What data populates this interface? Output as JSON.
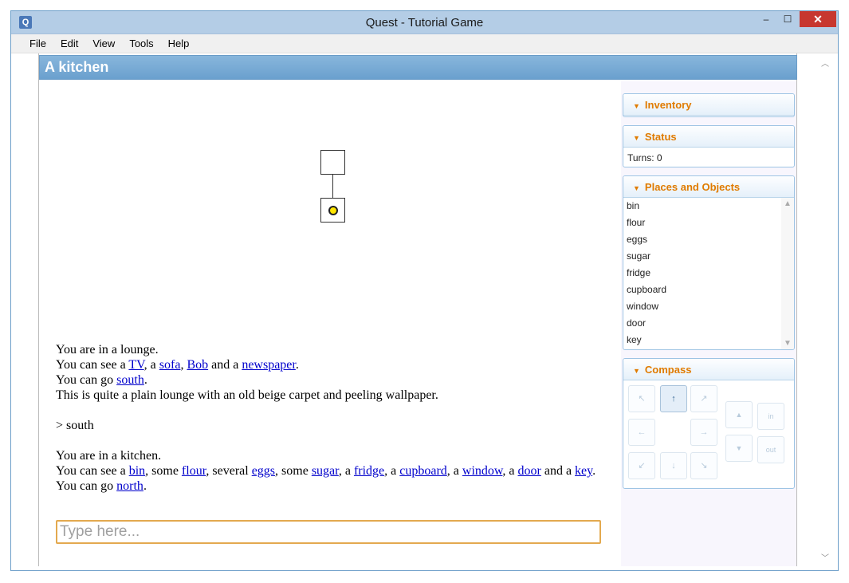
{
  "window": {
    "title": "Quest - Tutorial Game",
    "controls": {
      "minimize": "‒",
      "maximize": "☐",
      "close": "✕"
    }
  },
  "menu": [
    "File",
    "Edit",
    "View",
    "Tools",
    "Help"
  ],
  "location": {
    "title": "A kitchen"
  },
  "output": {
    "lines": [
      [
        {
          "t": "You are in a lounge."
        }
      ],
      [
        {
          "t": "You can see a "
        },
        {
          "t": "TV",
          "link": true
        },
        {
          "t": ", a "
        },
        {
          "t": "sofa",
          "link": true
        },
        {
          "t": ", "
        },
        {
          "t": "Bob",
          "link": true
        },
        {
          "t": " and a "
        },
        {
          "t": "newspaper",
          "link": true
        },
        {
          "t": "."
        }
      ],
      [
        {
          "t": "You can go "
        },
        {
          "t": "south",
          "link": true
        },
        {
          "t": "."
        }
      ],
      [
        {
          "t": "This is quite a plain lounge with an old beige carpet and peeling wallpaper."
        }
      ],
      [],
      [
        {
          "t": "> south"
        }
      ],
      [],
      [
        {
          "t": "You are in a kitchen."
        }
      ],
      [
        {
          "t": "You can see a "
        },
        {
          "t": "bin",
          "link": true
        },
        {
          "t": ", some "
        },
        {
          "t": "flour",
          "link": true
        },
        {
          "t": ", several "
        },
        {
          "t": "eggs",
          "link": true
        },
        {
          "t": ", some "
        },
        {
          "t": "sugar",
          "link": true
        },
        {
          "t": ", a "
        },
        {
          "t": "fridge",
          "link": true
        },
        {
          "t": ", a "
        },
        {
          "t": "cupboard",
          "link": true
        },
        {
          "t": ", a "
        },
        {
          "t": "window",
          "link": true
        },
        {
          "t": ", a "
        },
        {
          "t": "door",
          "link": true
        },
        {
          "t": " and a "
        },
        {
          "t": "key",
          "link": true
        },
        {
          "t": "."
        }
      ],
      [
        {
          "t": "You can go "
        },
        {
          "t": "north",
          "link": true
        },
        {
          "t": "."
        }
      ]
    ]
  },
  "command": {
    "placeholder": "Type here..."
  },
  "panels": {
    "inventory": {
      "title": "Inventory"
    },
    "status": {
      "title": "Status",
      "turns": "Turns: 0"
    },
    "places": {
      "title": "Places and Objects",
      "items": [
        "bin",
        "flour",
        "eggs",
        "sugar",
        "fridge",
        "cupboard",
        "window",
        "door",
        "key"
      ]
    },
    "compass": {
      "title": "Compass",
      "buttons": {
        "nw": "↖",
        "n": "↑",
        "ne": "↗",
        "w": "←",
        "e": "→",
        "sw": "↙",
        "s": "↓",
        "se": "↘",
        "up": "▲",
        "down": "▼",
        "in": "in",
        "out": "out"
      },
      "active": "n"
    }
  },
  "icons": {
    "collapse": "chevron-down-icon",
    "scroll_up": "▲",
    "scroll_down": "▼"
  }
}
